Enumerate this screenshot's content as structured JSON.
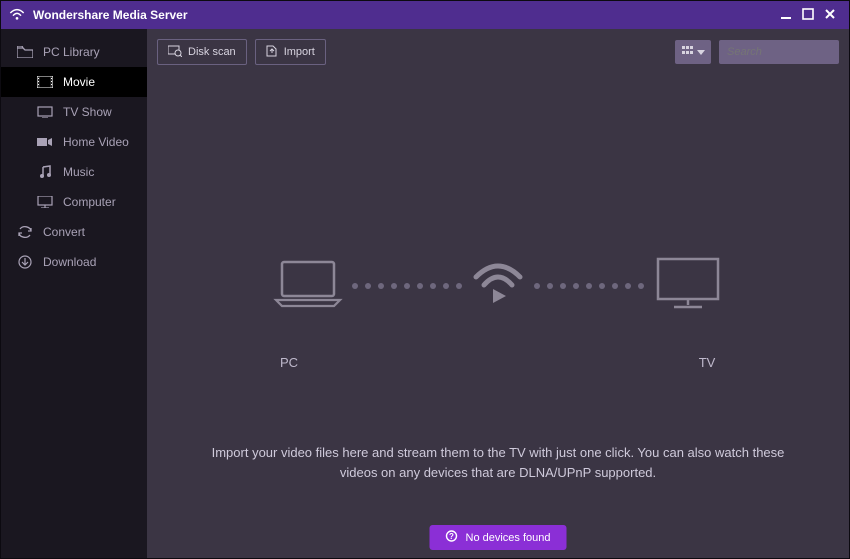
{
  "titlebar": {
    "app_name": "Wondershare Media Server"
  },
  "sidebar": {
    "library_header": "PC Library",
    "items": [
      {
        "label": "Movie"
      },
      {
        "label": "TV Show"
      },
      {
        "label": "Home Video"
      },
      {
        "label": "Music"
      },
      {
        "label": "Computer"
      }
    ],
    "convert": "Convert",
    "download": "Download"
  },
  "toolbar": {
    "disk_scan": "Disk scan",
    "import": "Import"
  },
  "search": {
    "placeholder": "Search"
  },
  "main": {
    "pc_label": "PC",
    "tv_label": "TV",
    "instruction": "Import your video files here and stream them to the TV with just one click. You can also watch these videos on any devices that are DLNA/UPnP supported."
  },
  "status": {
    "text": "No devices found"
  }
}
